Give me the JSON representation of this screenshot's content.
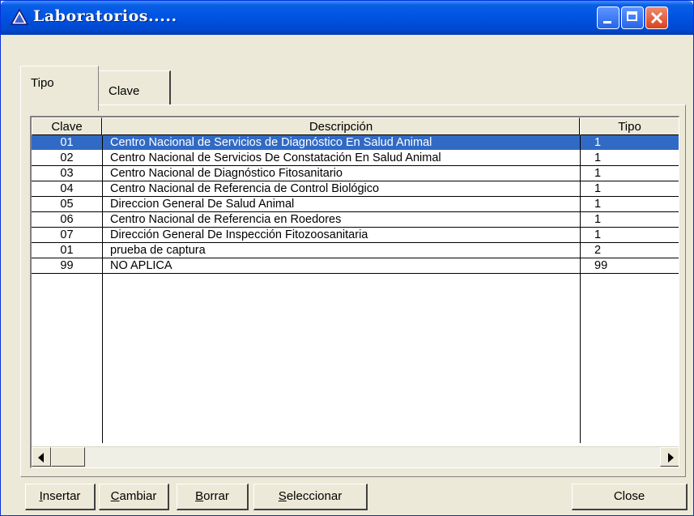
{
  "window": {
    "title": "Laboratorios.....",
    "icon": "triangle-icon"
  },
  "titlebar_buttons": {
    "minimize": "minimize-icon",
    "maximize": "maximize-icon",
    "close": "close-icon"
  },
  "tabs": [
    {
      "label": "Tipo",
      "active": true
    },
    {
      "label": "Clave",
      "active": false
    }
  ],
  "grid": {
    "columns": [
      "Clave",
      "Descripción",
      "Tipo"
    ],
    "rows": [
      {
        "clave": "01",
        "descripcion": "Centro Nacional de Servicios de Diagnóstico En Salud Animal",
        "tipo": "1",
        "selected": true
      },
      {
        "clave": "02",
        "descripcion": "Centro Nacional de Servicios De Constatación En Salud Animal",
        "tipo": "1"
      },
      {
        "clave": "03",
        "descripcion": "Centro Nacional de Diagnóstico Fitosanitario",
        "tipo": "1"
      },
      {
        "clave": "04",
        "descripcion": "Centro Nacional de Referencia de Control Biológico",
        "tipo": "1"
      },
      {
        "clave": "05",
        "descripcion": "Direccion General De Salud Animal",
        "tipo": "1"
      },
      {
        "clave": "06",
        "descripcion": "Centro Nacional de Referencia en Roedores",
        "tipo": "1"
      },
      {
        "clave": "07",
        "descripcion": "Dirección General De Inspección Fitozoosanitaria",
        "tipo": "1"
      },
      {
        "clave": "01",
        "descripcion": "prueba de captura",
        "tipo": "2"
      },
      {
        "clave": "99",
        "descripcion": "NO APLICA",
        "tipo": "99"
      }
    ]
  },
  "buttons": {
    "insertar": {
      "label": "Insertar",
      "accel": "I",
      "rest": "nsertar"
    },
    "cambiar": {
      "label": "Cambiar",
      "accel": "C",
      "rest": "ambiar"
    },
    "borrar": {
      "label": "Borrar",
      "accel": "B",
      "rest": "orrar"
    },
    "seleccionar": {
      "label": "Seleccionar",
      "accel": "S",
      "rest": "eleccionar"
    },
    "close": {
      "label": "Close"
    }
  },
  "colors": {
    "titlebar": "#0054e3",
    "selection": "#316ac5",
    "face": "#ece9d8",
    "close_button": "#d8431c"
  }
}
